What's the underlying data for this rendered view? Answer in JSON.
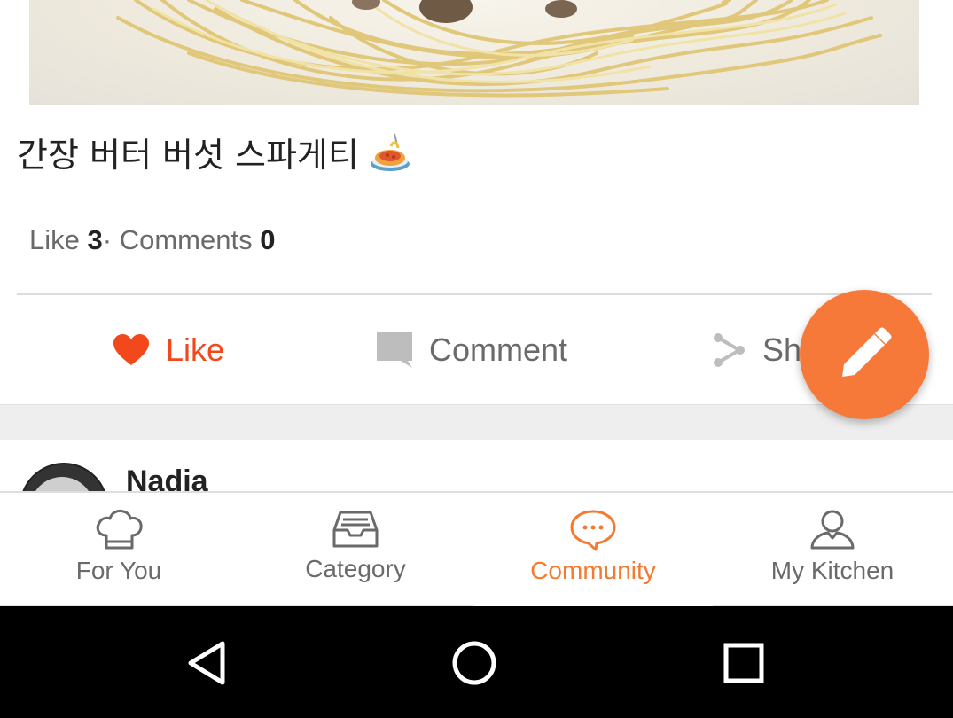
{
  "post": {
    "title": "간장 버터 버섯 스파게티",
    "title_emoji": "spaghetti-emoji",
    "stats": {
      "like_label": "Like",
      "like_count": "3",
      "separator": "·",
      "comments_label": "Comments",
      "comments_count": "0"
    }
  },
  "actions": {
    "like_label": "Like",
    "comment_label": "Comment",
    "share_label": "Sh"
  },
  "next_post": {
    "author_name": "Nadia"
  },
  "fab": {
    "icon": "pencil-icon"
  },
  "bottom_nav": {
    "items": [
      {
        "label": "For You",
        "icon": "chef-hat-icon"
      },
      {
        "label": "Category",
        "icon": "inbox-tray-icon"
      },
      {
        "label": "Community",
        "icon": "chat-bubble-icon",
        "active": true
      },
      {
        "label": "My Kitchen",
        "icon": "person-icon"
      }
    ]
  },
  "colors": {
    "accent": "#f47a31",
    "like_red": "#f1491b",
    "fab": "#f6793a",
    "text_gray": "#6a6a6a"
  }
}
